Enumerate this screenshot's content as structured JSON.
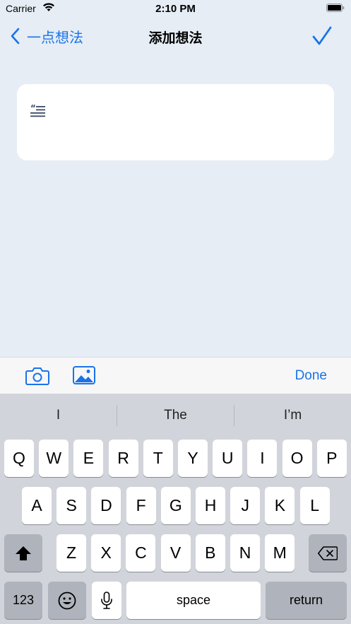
{
  "status_bar": {
    "carrier": "Carrier",
    "time": "2:10 PM"
  },
  "nav": {
    "back_label": "一点想法",
    "title": "添加想法"
  },
  "accessory": {
    "done_label": "Done"
  },
  "keyboard": {
    "suggestions": [
      "I",
      "The",
      "I’m"
    ],
    "row1": [
      "Q",
      "W",
      "E",
      "R",
      "T",
      "Y",
      "U",
      "I",
      "O",
      "P"
    ],
    "row2": [
      "A",
      "S",
      "D",
      "F",
      "G",
      "H",
      "J",
      "K",
      "L"
    ],
    "row3": [
      "Z",
      "X",
      "C",
      "V",
      "B",
      "N",
      "M"
    ],
    "numbers_label": "123",
    "space_label": "space",
    "return_label": "return"
  },
  "colors": {
    "accent": "#1a73e8",
    "background": "#e6edf5",
    "keyboard": "#d1d4da"
  }
}
